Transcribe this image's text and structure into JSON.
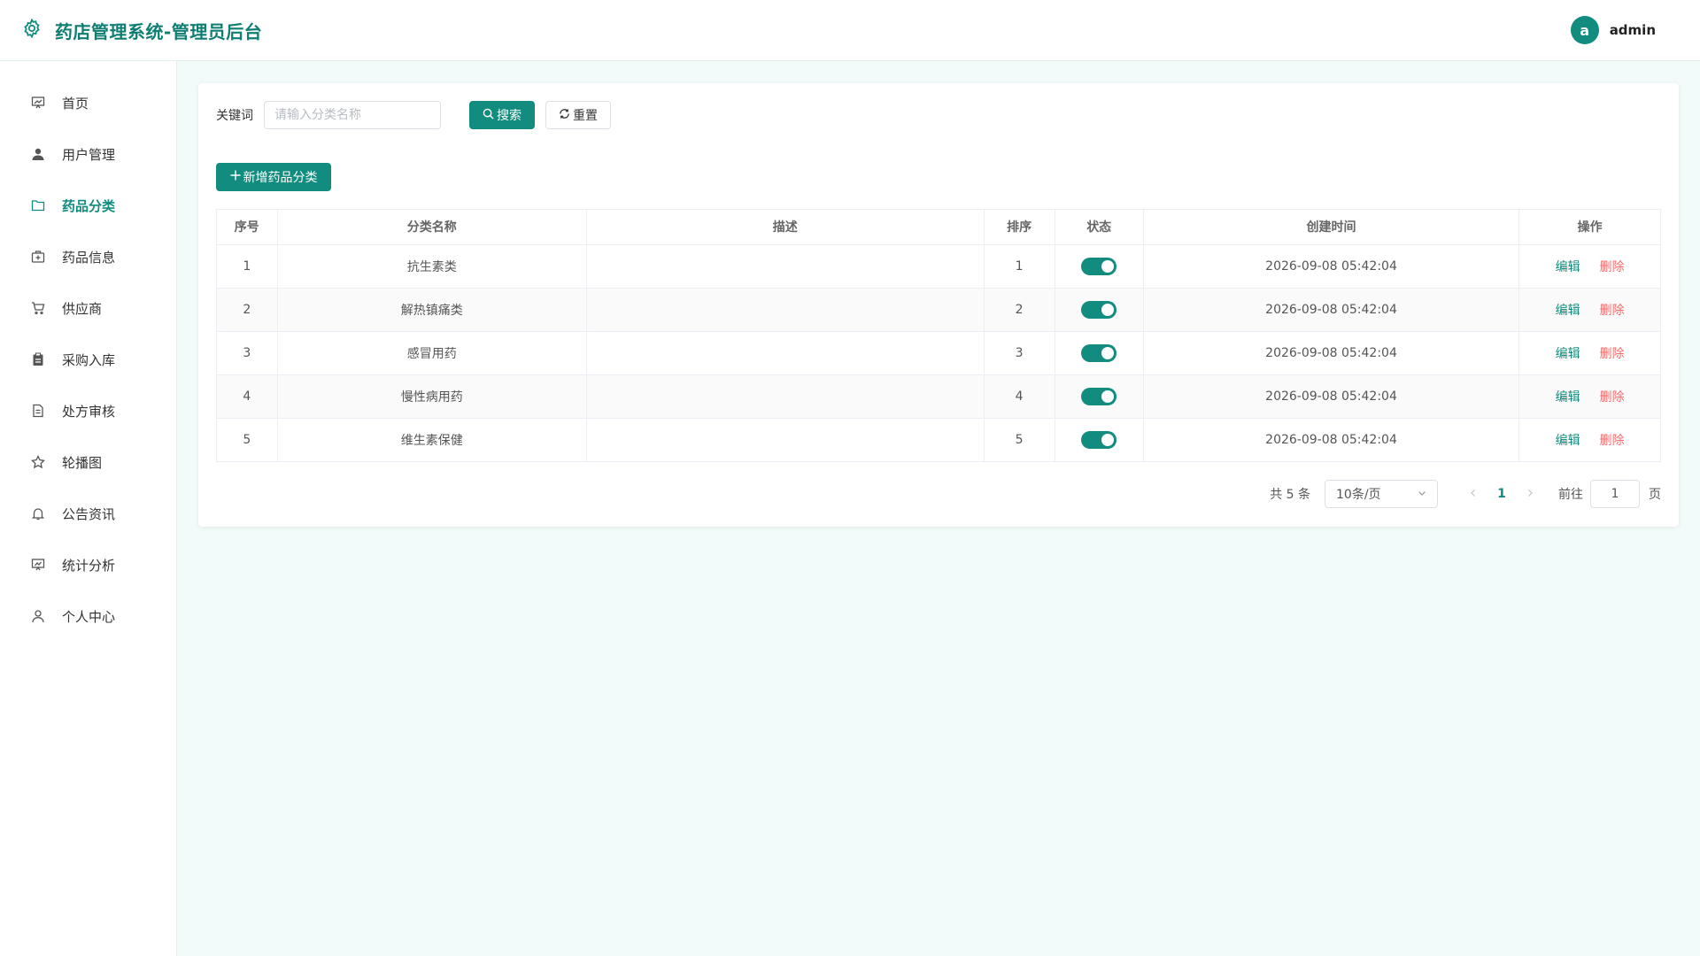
{
  "header": {
    "title": "药店管理系统-管理员后台",
    "avatar_letter": "a",
    "username": "admin"
  },
  "sidebar": {
    "items": [
      {
        "label": "首页",
        "icon": "dashboard-icon"
      },
      {
        "label": "用户管理",
        "icon": "user-icon"
      },
      {
        "label": "药品分类",
        "icon": "folder-icon",
        "active": true
      },
      {
        "label": "药品信息",
        "icon": "medicine-box-icon"
      },
      {
        "label": "供应商",
        "icon": "cart-icon"
      },
      {
        "label": "采购入库",
        "icon": "clipboard-icon"
      },
      {
        "label": "处方审核",
        "icon": "document-icon"
      },
      {
        "label": "轮播图",
        "icon": "star-icon"
      },
      {
        "label": "公告资讯",
        "icon": "bell-icon"
      },
      {
        "label": "统计分析",
        "icon": "chart-board-icon"
      },
      {
        "label": "个人中心",
        "icon": "person-icon"
      }
    ]
  },
  "search": {
    "label": "关键词",
    "placeholder": "请输入分类名称",
    "value": "",
    "search_label": "搜索",
    "reset_label": "重置"
  },
  "toolbar": {
    "add_label": "新增药品分类"
  },
  "table": {
    "columns": [
      "序号",
      "分类名称",
      "描述",
      "排序",
      "状态",
      "创建时间",
      "操作"
    ],
    "rows": [
      {
        "index": "1",
        "name": "抗生素类",
        "description": "",
        "sort": "1",
        "status": true,
        "created": "2026-09-08 05:42:04"
      },
      {
        "index": "2",
        "name": "解热镇痛类",
        "description": "",
        "sort": "2",
        "status": true,
        "created": "2026-09-08 05:42:04"
      },
      {
        "index": "3",
        "name": "感冒用药",
        "description": "",
        "sort": "3",
        "status": true,
        "created": "2026-09-08 05:42:04"
      },
      {
        "index": "4",
        "name": "慢性病用药",
        "description": "",
        "sort": "4",
        "status": true,
        "created": "2026-09-08 05:42:04"
      },
      {
        "index": "5",
        "name": "维生素保健",
        "description": "",
        "sort": "5",
        "status": true,
        "created": "2026-09-08 05:42:04"
      }
    ],
    "edit_label": "编辑",
    "delete_label": "删除"
  },
  "pagination": {
    "total_text": "共 5 条",
    "page_size": "10条/页",
    "current_page": "1",
    "goto_label": "前往",
    "goto_value": "1",
    "page_suffix": "页"
  },
  "colors": {
    "primary": "#118c7e",
    "danger": "#f56c6c",
    "background": "#f2fbf9"
  }
}
